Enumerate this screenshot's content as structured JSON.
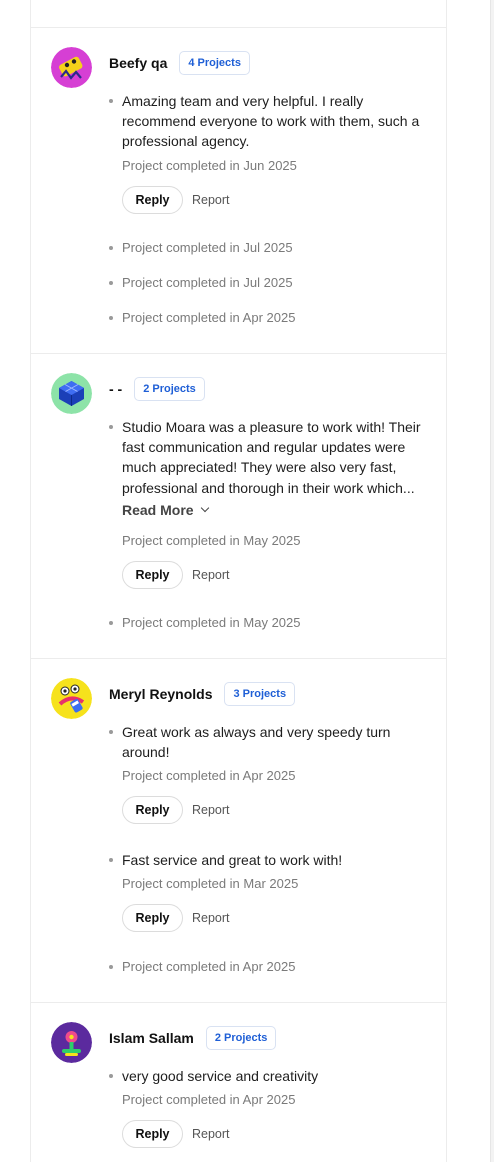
{
  "reviews": [
    {
      "name": "Beefy qa",
      "projects": "4 Projects",
      "entries": [
        {
          "text": "Amazing team and very helpful. I really recommend everyone to work with them, such a professional agency.",
          "meta": "Project completed in Jun 2025"
        }
      ],
      "extra": [
        "Project completed in Jul 2025",
        "Project completed in Jul 2025",
        "Project completed in Apr 2025"
      ]
    },
    {
      "name": "- -",
      "projects": "2 Projects",
      "entries": [
        {
          "text": "Studio Moara was a pleasure to work with! Their fast communication and regular updates were much appreciated! They were also very fast, professional and thorough in their work which...",
          "read_more": "Read More",
          "meta": "Project completed in May 2025"
        }
      ],
      "extra": [
        "Project completed in May 2025"
      ]
    },
    {
      "name": "Meryl Reynolds",
      "projects": "3 Projects",
      "entries": [
        {
          "text": "Great work as always and very speedy turn around!",
          "meta": "Project completed in Apr 2025"
        },
        {
          "text": "Fast service and great to work with!",
          "meta": "Project completed in Mar 2025"
        }
      ],
      "extra": [
        "Project completed in Apr 2025"
      ]
    },
    {
      "name": "Islam Sallam",
      "projects": "2 Projects",
      "entries": [
        {
          "text": "very good service and creativity",
          "meta": "Project completed in Apr 2025"
        }
      ],
      "extra": []
    }
  ],
  "actions": {
    "reply": "Reply",
    "report": "Report"
  },
  "colors": {
    "badge_text": "#1f5fd6",
    "border": "#ececec",
    "meta": "#7a7a7a"
  }
}
